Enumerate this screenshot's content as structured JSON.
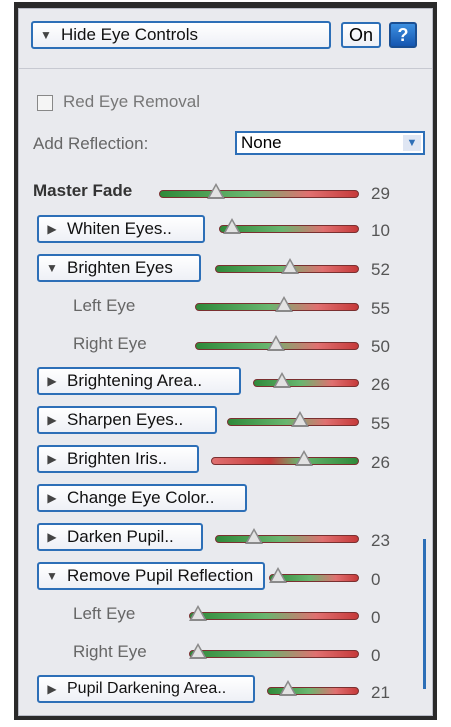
{
  "header": {
    "hide_label": "Hide Eye Controls",
    "on_label": "On",
    "help_label": "?"
  },
  "red_eye": {
    "label": "Red Eye Removal",
    "checked": false
  },
  "reflection": {
    "label": "Add Reflection:",
    "value": "None"
  },
  "master": {
    "label": "Master Fade",
    "value": "29"
  },
  "rows": [
    {
      "label": "Whiten Eyes..",
      "value": "10",
      "expanded": false
    },
    {
      "label": "Brighten Eyes",
      "value": "52",
      "expanded": true
    },
    {
      "label": "Left Eye",
      "value": "55"
    },
    {
      "label": "Right Eye",
      "value": "50"
    },
    {
      "label": "Brightening Area..",
      "value": "26",
      "expanded": false
    },
    {
      "label": "Sharpen Eyes..",
      "value": "55",
      "expanded": false
    },
    {
      "label": "Brighten Iris..",
      "value": "26",
      "expanded": false
    },
    {
      "label": "Change Eye Color..",
      "expanded": false
    },
    {
      "label": "Darken Pupil..",
      "value": "23",
      "expanded": false
    },
    {
      "label": "Remove Pupil Reflection",
      "value": "0",
      "expanded": true
    },
    {
      "label": "Left Eye",
      "value": "0"
    },
    {
      "label": "Right Eye",
      "value": "0"
    },
    {
      "label": "Pupil Darkening Area..",
      "value": "21",
      "expanded": false
    }
  ],
  "icons": {
    "collapsed": "play-triangle-icon",
    "expanded": "down-triangle-icon",
    "dropdown": "chevron-down-icon"
  }
}
